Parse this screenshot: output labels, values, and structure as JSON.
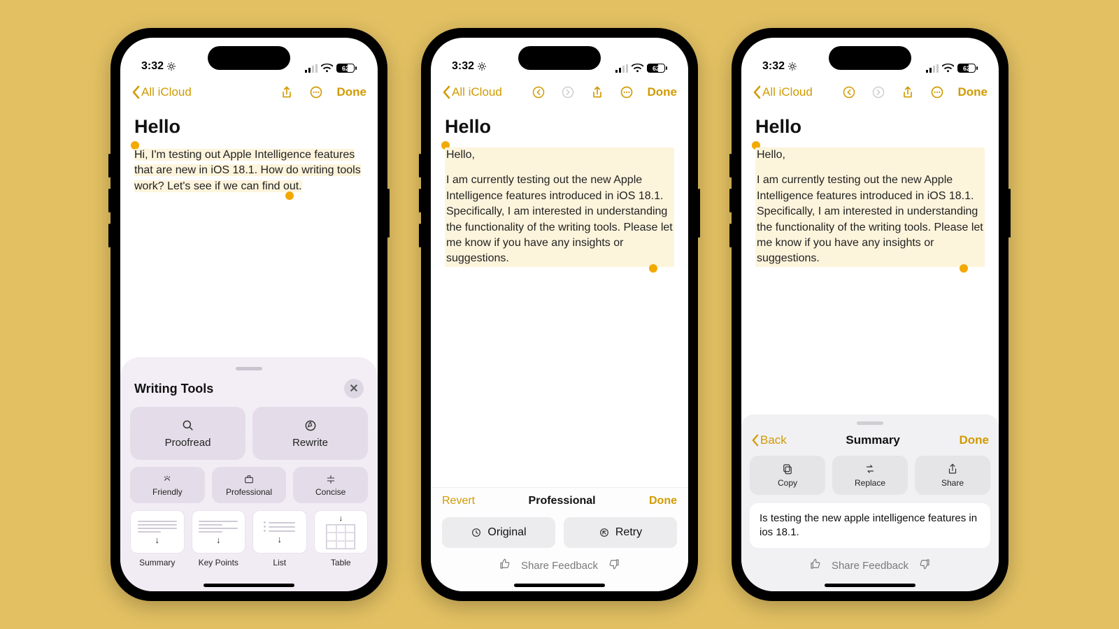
{
  "status": {
    "time": "3:32",
    "battery": "62"
  },
  "nav": {
    "back_label": "All iCloud",
    "done": "Done"
  },
  "note": {
    "title": "Hello",
    "original_text": "Hi, I'm testing out Apple Intelligence features that are new in iOS 18.1. How do writing tools work? Let's see if we can find out.",
    "rewritten_greeting": "Hello,",
    "rewritten_body": "I am currently testing out the new Apple Intelligence features introduced in iOS 18.1. Specifically, I am interested in understanding the functionality of the writing tools. Please let me know if you have any insights or suggestions."
  },
  "writing_tools": {
    "title": "Writing Tools",
    "proofread": "Proofread",
    "rewrite": "Rewrite",
    "styles": {
      "friendly": "Friendly",
      "professional": "Professional",
      "concise": "Concise"
    },
    "formats": {
      "summary": "Summary",
      "key_points": "Key Points",
      "list": "List",
      "table": "Table"
    }
  },
  "result_bar": {
    "revert": "Revert",
    "mode": "Professional",
    "done": "Done",
    "original": "Original",
    "retry": "Retry",
    "share_feedback": "Share Feedback"
  },
  "summary_sheet": {
    "back": "Back",
    "title": "Summary",
    "done": "Done",
    "actions": {
      "copy": "Copy",
      "replace": "Replace",
      "share": "Share"
    },
    "summary_text": "Is testing the new apple intelligence features in ios 18.1.",
    "share_feedback": "Share Feedback"
  }
}
